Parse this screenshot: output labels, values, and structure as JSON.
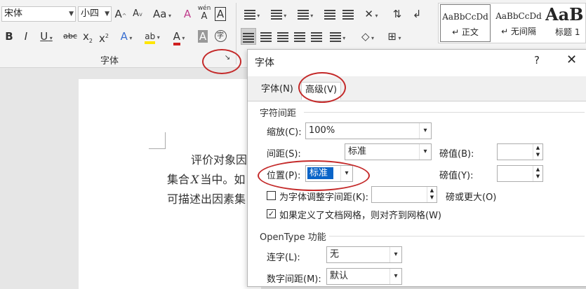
{
  "ribbon": {
    "font_name": "宋体",
    "font_size": "小四",
    "grow_font": "A",
    "shrink_font": "A",
    "change_case": "Aa",
    "clear_format": "A",
    "phonetic": "wén",
    "char_border": "A",
    "bold": "B",
    "italic": "I",
    "underline": "U",
    "strike": "abc",
    "subscript": "x",
    "subscript_mark": "2",
    "superscript": "x",
    "superscript_mark": "2",
    "text_effect": "A",
    "highlight": "ab",
    "font_color": "A",
    "char_shading": "A",
    "enclose": "字",
    "font_group_label": "字体",
    "launcher": "↘",
    "styles": [
      {
        "sample": "AaBbCcDd",
        "name": "↵ 正文"
      },
      {
        "sample": "AaBbCcDd",
        "name": "↵ 无间隔"
      },
      {
        "sample": "AaB",
        "name": "标题 1"
      }
    ]
  },
  "document": {
    "line1": "评价对象因",
    "line2_a": "集合",
    "line2_x": "X",
    "line2_b": "当中。如",
    "line3": "可描述出因素集"
  },
  "dialog": {
    "title": "字体",
    "help": "?",
    "close": "✕",
    "tabs": [
      {
        "label": "字体(N)",
        "underline_char": "N",
        "active": false
      },
      {
        "label": "高级(V)",
        "underline_char": "V",
        "active": true
      }
    ],
    "char_spacing_section": "字符间距",
    "scale": {
      "label": "缩放(C):",
      "value": "100%"
    },
    "spacing": {
      "label": "间距(S):",
      "value": "标准",
      "pt_label": "磅值(B):",
      "pt_value": ""
    },
    "position": {
      "label": "位置(P):",
      "value": "标准",
      "pt_label": "磅值(Y):",
      "pt_value": ""
    },
    "kerning": {
      "label": "为字体调整字间距(K):",
      "value": "",
      "suffix": "磅或更大(O)",
      "checked": false
    },
    "snap_grid": {
      "label": "如果定义了文档网格，则对齐到网格(W)",
      "checked": true
    },
    "opentype_section": "OpenType 功能",
    "ligatures": {
      "label": "连字(L):",
      "value": "无"
    },
    "number_spacing": {
      "label": "数字间距(M):",
      "value": "默认"
    }
  },
  "colors": {
    "accent": "#c42a2a",
    "selection": "#0a64c8"
  }
}
